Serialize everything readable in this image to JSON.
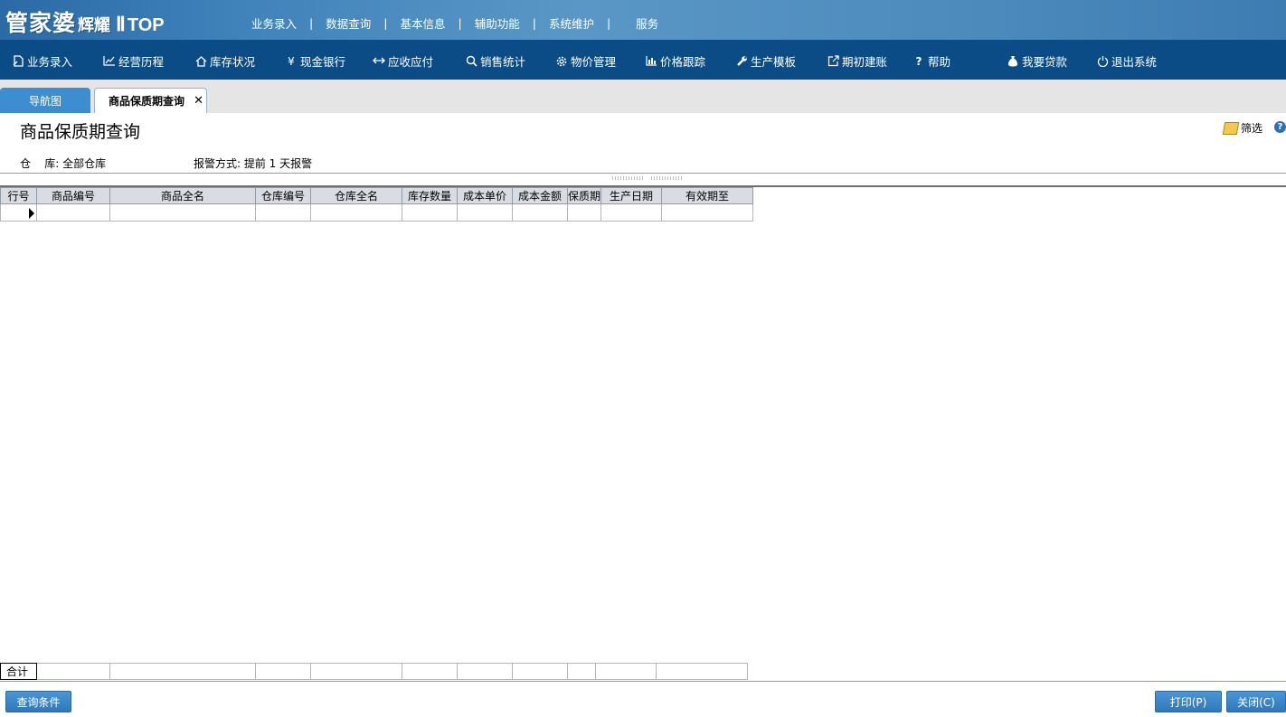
{
  "app": {
    "brand": "管家婆",
    "brand_sub": "辉耀",
    "version": "Ⅱ",
    "edition": "TOP"
  },
  "top_nav": [
    "业务录入",
    "数据查询",
    "基本信息",
    "辅助功能",
    "系统维护",
    "服务"
  ],
  "main_nav": [
    {
      "label": "业务录入",
      "icon": "document-icon"
    },
    {
      "label": "经营历程",
      "icon": "line-chart-icon"
    },
    {
      "label": "库存状况",
      "icon": "home-icon"
    },
    {
      "label": "现金银行",
      "icon": "yen-icon"
    },
    {
      "label": "应收应付",
      "icon": "arrows-icon"
    },
    {
      "label": "销售统计",
      "icon": "search-icon"
    },
    {
      "label": "物价管理",
      "icon": "gear-icon"
    },
    {
      "label": "价格跟踪",
      "icon": "bar-chart-icon"
    },
    {
      "label": "生产模板",
      "icon": "wrench-icon"
    },
    {
      "label": "期初建账",
      "icon": "external-link-icon"
    },
    {
      "label": "帮助",
      "icon": "question-icon"
    },
    {
      "label": "我要贷款",
      "icon": "money-bag-icon"
    },
    {
      "label": "退出系统",
      "icon": "power-icon"
    }
  ],
  "tabs": {
    "nav": "导航图",
    "active": "商品保质期查询",
    "close": "✕"
  },
  "page": {
    "title": "商品保质期查询",
    "filter_label": "筛选",
    "help": "?",
    "warehouse_label": "仓    库: 全部仓库",
    "alarm_label": "报警方式: 提前 1 天报警"
  },
  "grid": {
    "columns": [
      "行号",
      "商品编号",
      "商品全名",
      "仓库编号",
      "仓库全名",
      "库存数量",
      "成本单价",
      "成本金额",
      "保质期",
      "生产日期",
      "有效期至"
    ],
    "total_label": "合计"
  },
  "buttons": {
    "query": "查询条件",
    "print": "打印(P)",
    "close": "关闭(C)"
  }
}
